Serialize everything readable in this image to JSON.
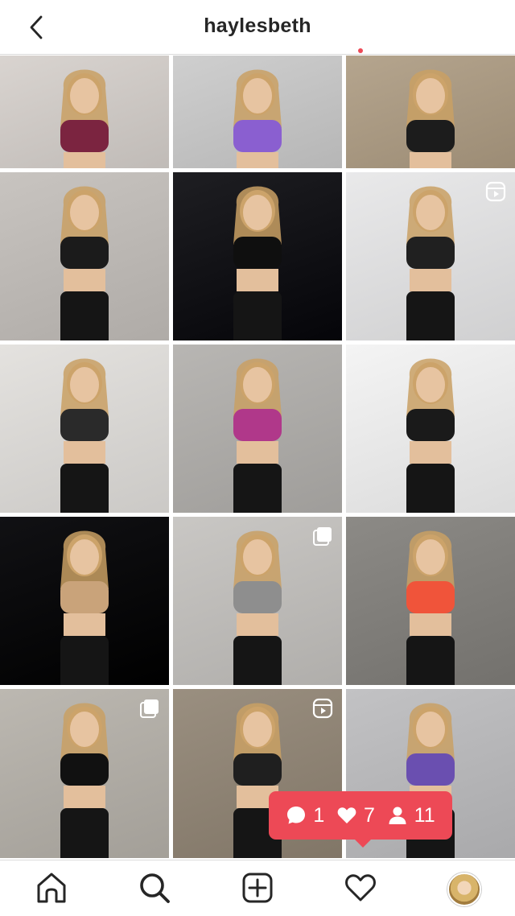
{
  "header": {
    "title": "haylesbeth",
    "back_icon": "chevron-left-icon"
  },
  "grid": {
    "tiles": [
      {
        "name": "post-mirror-selfie-maroon",
        "bg": "#d9d4d0",
        "accent": "#7b2440",
        "badge": ""
      },
      {
        "name": "post-purple-sports-bra",
        "bg": "#cfcfcf",
        "accent": "#8a5fd0",
        "badge": ""
      },
      {
        "name": "post-dumbbells-wall-bars",
        "bg": "#b5a58e",
        "accent": "#1c1c1c",
        "badge": ""
      },
      {
        "name": "post-laughing-under-armour",
        "bg": "#c8c4c0",
        "accent": "#1b1b1b",
        "badge": ""
      },
      {
        "name": "post-dumbbell-curl-dark",
        "bg": "#1e1e22",
        "accent": "#0f0f0f",
        "badge": ""
      },
      {
        "name": "post-bent-over-row",
        "bg": "#e9e9ea",
        "accent": "#202020",
        "badge": "reel"
      },
      {
        "name": "post-black-hoodie-selfie",
        "bg": "#e4e2df",
        "accent": "#2a2a2a",
        "badge": ""
      },
      {
        "name": "post-magenta-jacket-stretch",
        "bg": "#b8b6b3",
        "accent": "#b0388a",
        "badge": ""
      },
      {
        "name": "post-team-sweat-duo",
        "bg": "#f4f4f4",
        "accent": "#1a1a1a",
        "badge": ""
      },
      {
        "name": "post-dumbbell-raise-night",
        "bg": "#111114",
        "accent": "#c9a37a",
        "badge": ""
      },
      {
        "name": "post-femme-sweatshirt",
        "bg": "#c9c7c4",
        "accent": "#8e8e8e",
        "badge": "carousel"
      },
      {
        "name": "post-orange-bra-selfie",
        "bg": "#8c8a86",
        "accent": "#f0543a",
        "badge": ""
      },
      {
        "name": "post-running-street",
        "bg": "#bcb8b1",
        "accent": "#111111",
        "badge": "carousel"
      },
      {
        "name": "post-gym-wall-bars",
        "bg": "#9a8f80",
        "accent": "#1f1f1f",
        "badge": "reel"
      },
      {
        "name": "post-purple-leggings-gym",
        "bg": "#c2c2c4",
        "accent": "#6a4fb0",
        "badge": ""
      }
    ]
  },
  "activity_popup": {
    "comments": "1",
    "likes": "7",
    "follows": "11",
    "icons": [
      "comment-icon",
      "heart-icon",
      "person-icon"
    ],
    "color": "#ed4956"
  },
  "bottom_nav": {
    "items": [
      "home-icon",
      "search-icon",
      "new-post-icon",
      "activity-heart-icon",
      "profile-avatar"
    ]
  }
}
